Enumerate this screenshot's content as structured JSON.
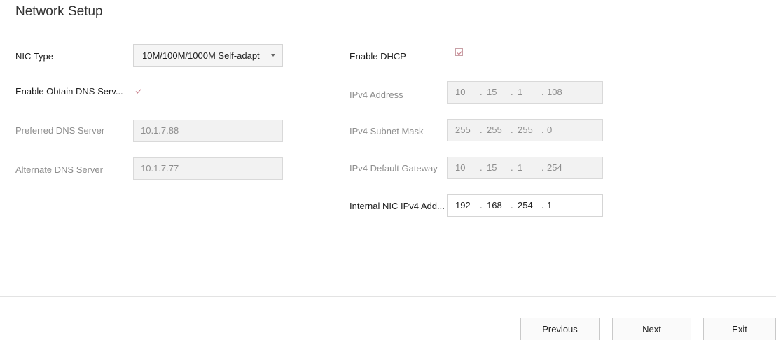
{
  "page": {
    "title": "Network Setup"
  },
  "left": {
    "nic_type": {
      "label": "NIC Type",
      "value": "10M/100M/1000M Self-adapt"
    },
    "obtain_dns": {
      "label": "Enable Obtain DNS Serv...",
      "checked": true
    },
    "preferred_dns": {
      "label": "Preferred DNS Server",
      "value": "10.1.7.88"
    },
    "alternate_dns": {
      "label": "Alternate DNS Server",
      "value": "10.1.7.77"
    }
  },
  "right": {
    "dhcp": {
      "label": "Enable DHCP",
      "checked": true
    },
    "ipv4_address": {
      "label": "IPv4 Address",
      "octets": [
        "10",
        "15",
        "1",
        "108"
      ]
    },
    "subnet_mask": {
      "label": "IPv4 Subnet Mask",
      "octets": [
        "255",
        "255",
        "255",
        "0"
      ]
    },
    "gateway": {
      "label": "IPv4 Default Gateway",
      "octets": [
        "10",
        "15",
        "1",
        "254"
      ]
    },
    "internal_nic": {
      "label": "Internal NIC IPv4 Add...",
      "octets": [
        "192",
        "168",
        "254",
        "1"
      ]
    }
  },
  "ip_separator": ".",
  "footer": {
    "previous_label": "Previous",
    "next_label": "Next",
    "exit_label": "Exit"
  },
  "colors": {
    "check_accent": "#c87f8a",
    "disabled_fill": "#f2f2f2",
    "disabled_text": "#8e8e8e"
  },
  "icons": {
    "dropdown": "chevron-down-icon",
    "checkbox": "check-icon"
  }
}
